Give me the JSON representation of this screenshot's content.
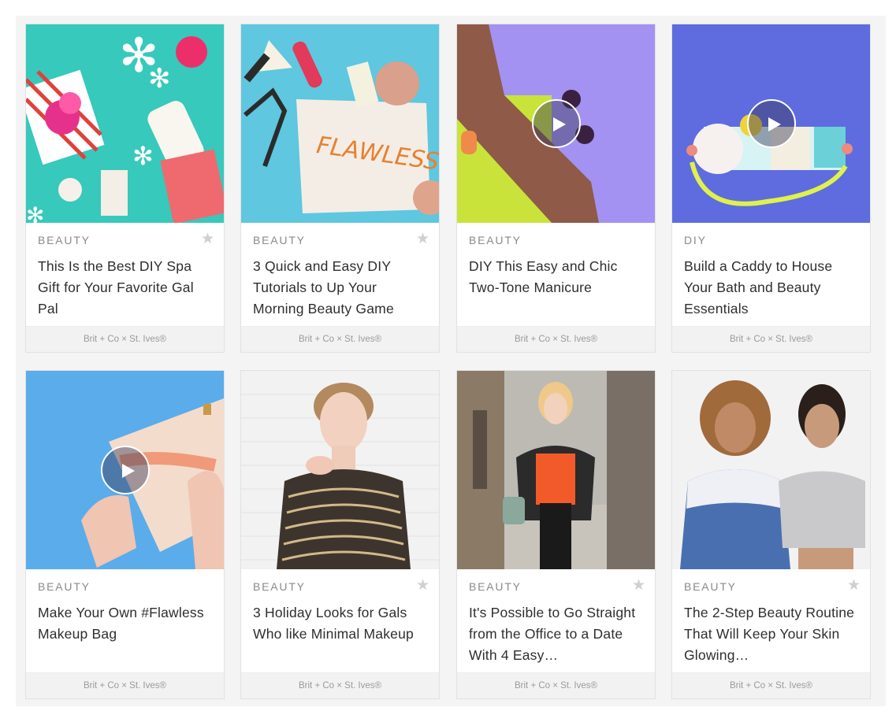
{
  "sponsor_label": "Brit + Co × St. Ives®",
  "cards": [
    {
      "category": "BEAUTY",
      "title": "This Is the Best DIY Spa Gift for Your Favorite Gal Pal",
      "star": "★",
      "sponsor": "Brit + Co × St. Ives®"
    },
    {
      "category": "BEAUTY",
      "title": "3 Quick and Easy DIY Tutorials to Up Your Morning Beauty Game",
      "star": "★",
      "sponsor": "Brit + Co × St. Ives®"
    },
    {
      "category": "BEAUTY",
      "title": "DIY This Easy and Chic Two-Tone Manicure",
      "star": "",
      "sponsor": "Brit + Co × St. Ives®"
    },
    {
      "category": "DIY",
      "title": "Build a Caddy to House Your Bath and Beauty Essentials",
      "star": "",
      "sponsor": "Brit + Co × St. Ives®"
    },
    {
      "category": "BEAUTY",
      "title": "Make Your Own #Flawless Makeup Bag",
      "star": "",
      "sponsor": "Brit + Co × St. Ives®"
    },
    {
      "category": "BEAUTY",
      "title": "3 Holiday Looks for Gals Who like Minimal Makeup",
      "star": "★",
      "sponsor": "Brit + Co × St. Ives®"
    },
    {
      "category": "BEAUTY",
      "title": "It's Possible to Go Straight from the Office to a Date With 4 Easy…",
      "star": "★",
      "sponsor": "Brit + Co × St. Ives®"
    },
    {
      "category": "BEAUTY",
      "title": "The 2-Step Beauty Routine That Will Keep Your Skin Glowing…",
      "star": "★",
      "sponsor": "Brit + Co × St. Ives®"
    }
  ],
  "colors": {
    "thumb_teal": "#37c9bb",
    "thumb_sky": "#5fc7df",
    "thumb_lavender": "#a392f2",
    "thumb_indigo": "#5e6ce0",
    "thumb_blue": "#5bacea",
    "thumb_white_brick": "#f2f2f2"
  }
}
